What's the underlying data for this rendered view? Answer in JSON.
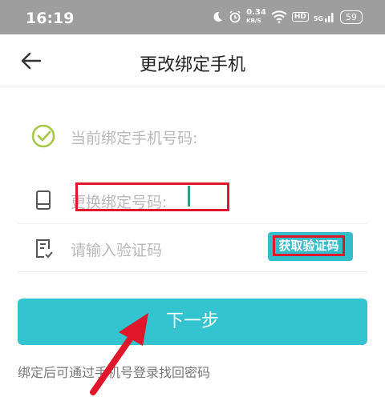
{
  "status_bar": {
    "time": "16:19",
    "net_speed_value": "0.34",
    "net_speed_unit": "KB/S",
    "hd": "HD",
    "signal": "5G",
    "battery": "59",
    "moon_icon": "moon-icon",
    "alarm_icon": "alarm-icon",
    "wifi_icon": "wifi-icon"
  },
  "header": {
    "back_icon": "arrow-left-icon",
    "title": "更改绑定手机"
  },
  "form": {
    "current_label": "当前绑定手机号码:",
    "new_label": "更换绑定号码:",
    "code_placeholder": "请输入验证码",
    "get_code_label": "获取验证码"
  },
  "next_button": "下一步",
  "hint": "绑定后可通过手机号登录找回密码",
  "colors": {
    "accent": "#33c4cf",
    "highlight": "#e0162b",
    "check": "#a8c84a"
  }
}
